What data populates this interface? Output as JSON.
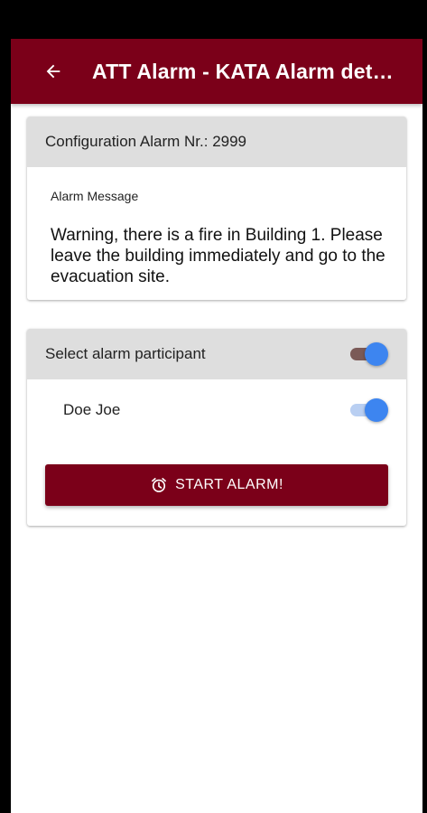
{
  "appbar": {
    "title": "ATT Alarm - KATA Alarm det…",
    "back_icon": "arrow-left-icon"
  },
  "config_card": {
    "header": "Configuration Alarm Nr.: 2999",
    "message_label": "Alarm Message",
    "message_text": "Warning, there is a fire in Building 1. Please leave the building immediately and go to the evacuation site."
  },
  "participants_card": {
    "header": "Select alarm participant",
    "select_all_on": true,
    "participants": [
      {
        "name": "Doe Joe",
        "selected": true
      }
    ],
    "start_button": {
      "label": "START ALARM!",
      "icon": "alarm-clock-icon"
    }
  },
  "colors": {
    "primary": "#7b0019",
    "header_gray": "#dedede",
    "toggle_thumb": "#3d85f0"
  }
}
